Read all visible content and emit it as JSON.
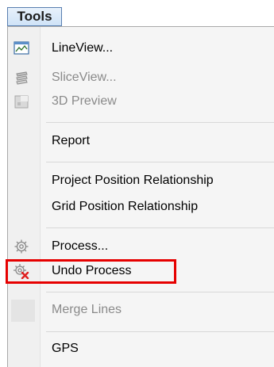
{
  "menu": {
    "title": "Tools"
  },
  "items": [
    {
      "label": "LineView...",
      "icon": "lineview-icon",
      "disabled": false
    },
    {
      "label": "SliceView...",
      "icon": "sliceview-icon",
      "disabled": true
    },
    {
      "label": "3D Preview",
      "icon": "3d-preview-icon",
      "disabled": true
    },
    {
      "label": "Report",
      "submenu": true
    },
    {
      "label": "Project Position Relationship",
      "submenu": true
    },
    {
      "label": "Grid Position Relationship",
      "submenu": true
    },
    {
      "label": "Process...",
      "icon": "gear-icon"
    },
    {
      "label": "Undo Process",
      "icon": "gear-undo-icon",
      "highlighted": true
    },
    {
      "label": "Merge Lines",
      "disabled": true
    },
    {
      "label": "GPS",
      "submenu": true
    }
  ],
  "colors": {
    "highlight_border": "#e60000",
    "disabled_text": "#8a8a8a",
    "menu_button_border": "#5a7fb0"
  }
}
